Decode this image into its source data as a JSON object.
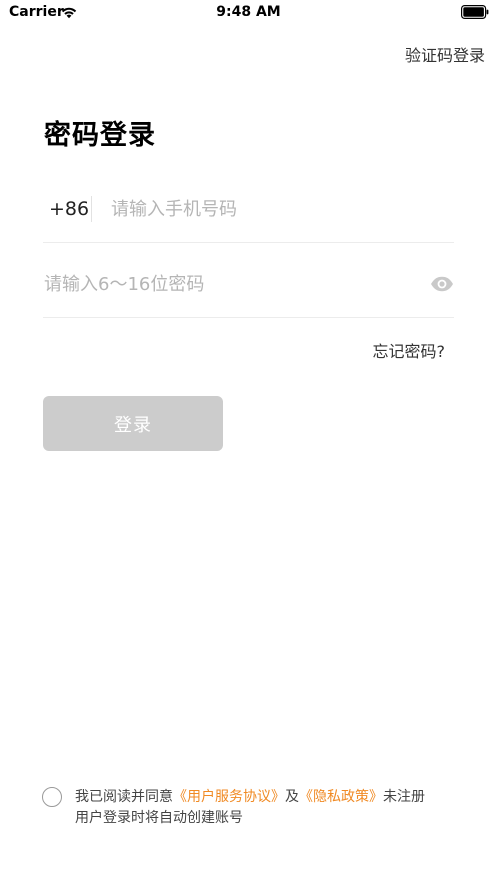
{
  "status_bar": {
    "carrier": "Carrier",
    "time": "9:48 AM"
  },
  "header": {
    "switch_label": "验证码登录"
  },
  "title": "密码登录",
  "phone": {
    "country_code": "+86",
    "placeholder": "请输入手机号码",
    "value": ""
  },
  "password": {
    "placeholder": "请输入6～16位密码",
    "value": "",
    "toggle_icon": "eye-icon"
  },
  "forgot_label": "忘记密码?",
  "login_label": "登录",
  "agreement": {
    "prefix": "我已阅读并同意",
    "user_agreement": "《用户服务协议》",
    "conjunction": "及",
    "privacy_policy": "《隐私政策》",
    "suffix": "未注册用户登录时将自动创建账号",
    "checked": false
  },
  "colors": {
    "accent": "#f08a24",
    "button_disabled": "#cccccc",
    "placeholder": "#b5b5b5",
    "divider": "#ececec"
  }
}
